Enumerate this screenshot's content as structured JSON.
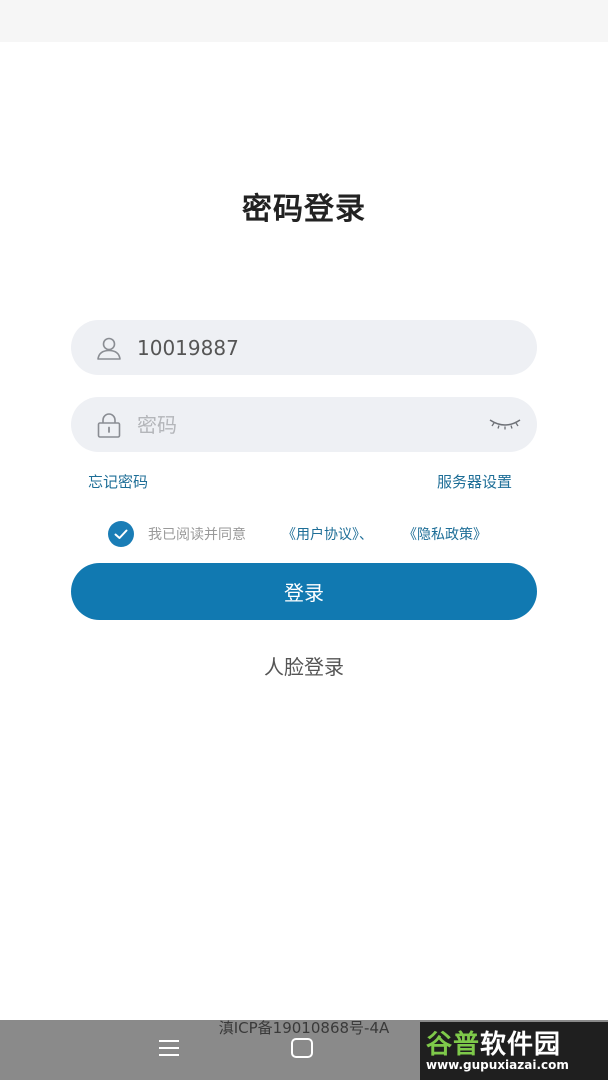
{
  "page": {
    "title": "密码登录"
  },
  "username": {
    "value": "10019887",
    "placeholder": ""
  },
  "password": {
    "value": "",
    "placeholder": "密码"
  },
  "links": {
    "forgot": "忘记密码",
    "server": "服务器设置"
  },
  "agreement": {
    "checked": true,
    "prefix": "我已阅读并同意",
    "user_agreement": "《用户协议》、",
    "privacy_policy": "《隐私政策》"
  },
  "buttons": {
    "login": "登录",
    "face_login": "人脸登录"
  },
  "footer": {
    "icp": "滇ICP备19010868号-4A"
  },
  "watermark": {
    "part1": "谷普",
    "part2": "软件园",
    "url": "www.gupuxiazai.com"
  },
  "colors": {
    "primary": "#1179b1",
    "link": "#1e6e97",
    "field_bg": "#eef0f4"
  },
  "icons": [
    "user-icon",
    "lock-icon",
    "eye-closed-icon",
    "check-icon",
    "menu-icon",
    "home-icon"
  ]
}
